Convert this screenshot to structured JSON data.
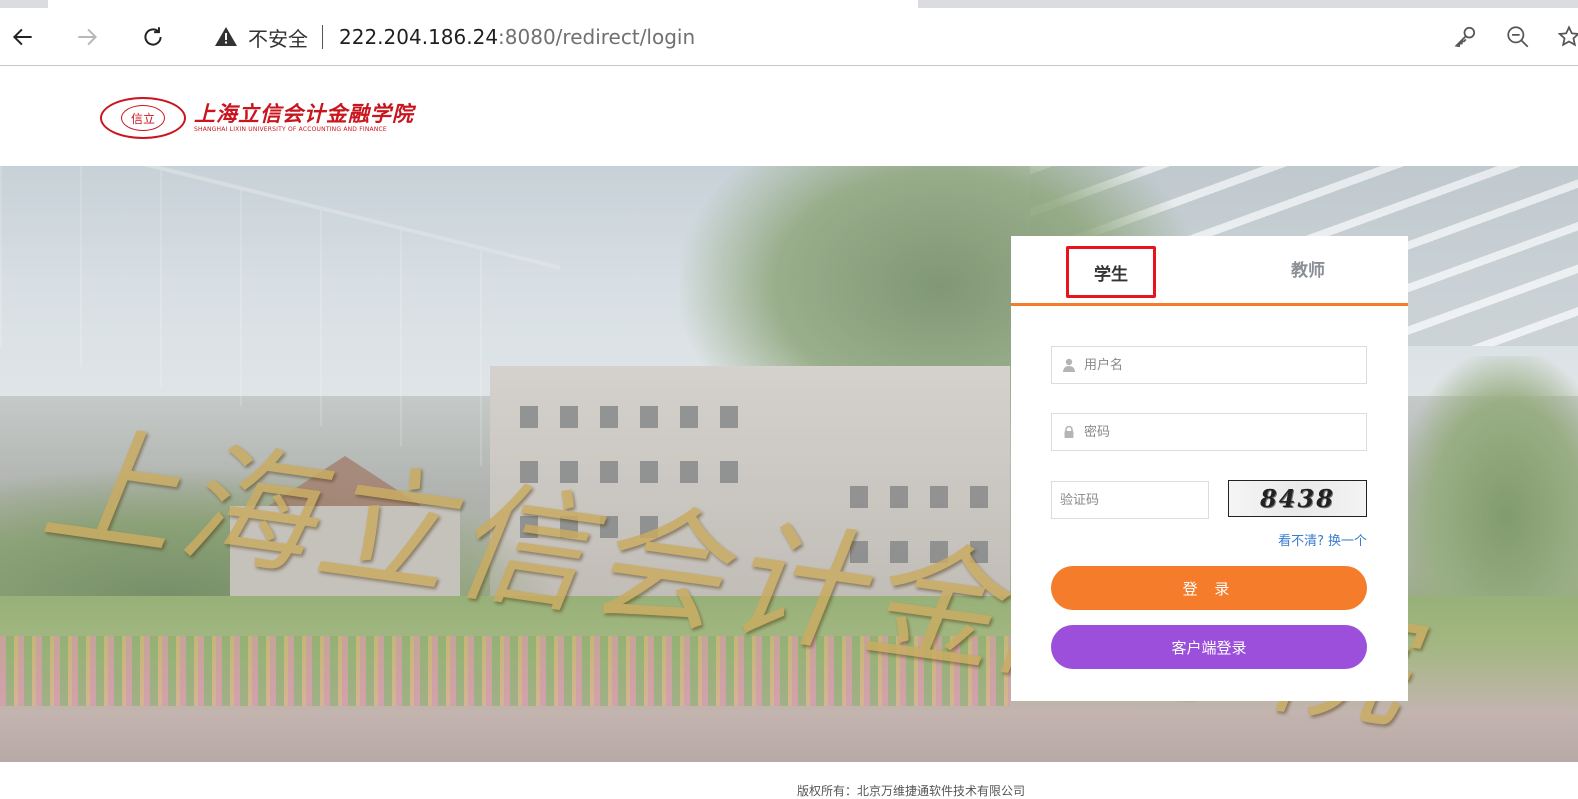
{
  "browser": {
    "security_label": "不安全",
    "url_host": "222.204.186.24",
    "url_rest": ":8080/redirect/login"
  },
  "header": {
    "logo_seal_text": "信立",
    "logo_name_cn": "上海立信会计金融学院",
    "logo_name_en": "SHANGHAI LIXIN UNIVERSITY OF ACCOUNTING AND FINANCE"
  },
  "banner": {
    "calligraphy": "上海立信会计金融学院"
  },
  "login": {
    "tabs": [
      {
        "label": "学生",
        "active": true
      },
      {
        "label": "教师",
        "active": false
      }
    ],
    "username_placeholder": "用户名",
    "password_placeholder": "密码",
    "captcha_placeholder": "验证码",
    "captcha_text": "8438",
    "refresh_q": "看不清?",
    "refresh_link": "换一个",
    "login_button": "登 录",
    "client_login_button": "客户端登录"
  },
  "footer": {
    "copyright": "版权所有：北京万维捷通软件技术有限公司"
  },
  "colors": {
    "accent_orange": "#f47c2a",
    "client_purple": "#9b4fdb",
    "highlight_red": "#e8131b",
    "link_blue": "#3a7ccf",
    "brand_red": "#c9151e"
  }
}
